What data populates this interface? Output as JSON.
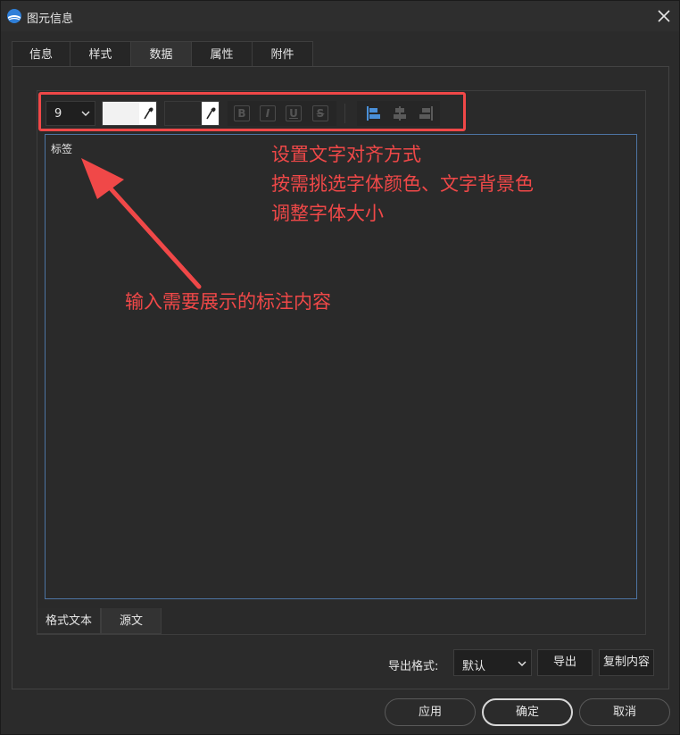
{
  "window": {
    "title": "图元信息"
  },
  "tabs": [
    {
      "label": "信息"
    },
    {
      "label": "样式"
    },
    {
      "label": "数据",
      "active": true
    },
    {
      "label": "属性"
    },
    {
      "label": "附件"
    }
  ],
  "toolbar": {
    "font_size": "9",
    "font_color": "#f2f2f2",
    "background_color": "#2a2a2a",
    "format_buttons": [
      "B",
      "I",
      "U",
      "S"
    ],
    "align_icons": [
      "align-left-icon",
      "align-center-icon",
      "align-right-icon"
    ]
  },
  "editor": {
    "content": "标签"
  },
  "annotations": {
    "toolbar_lines": [
      "设置文字对齐方式",
      "按需挑选字体颜色、文字背景色",
      "调整字体大小"
    ],
    "content_label": "输入需要展示的标注内容",
    "color": "#f04848"
  },
  "subtabs": [
    {
      "label": "格式文本",
      "active": true
    },
    {
      "label": "源文"
    }
  ],
  "export": {
    "label": "导出格式:",
    "selected": "默认",
    "export_button": "导出",
    "copy_button": "复制内容"
  },
  "footer": {
    "apply": "应用",
    "ok": "确定",
    "cancel": "取消"
  }
}
